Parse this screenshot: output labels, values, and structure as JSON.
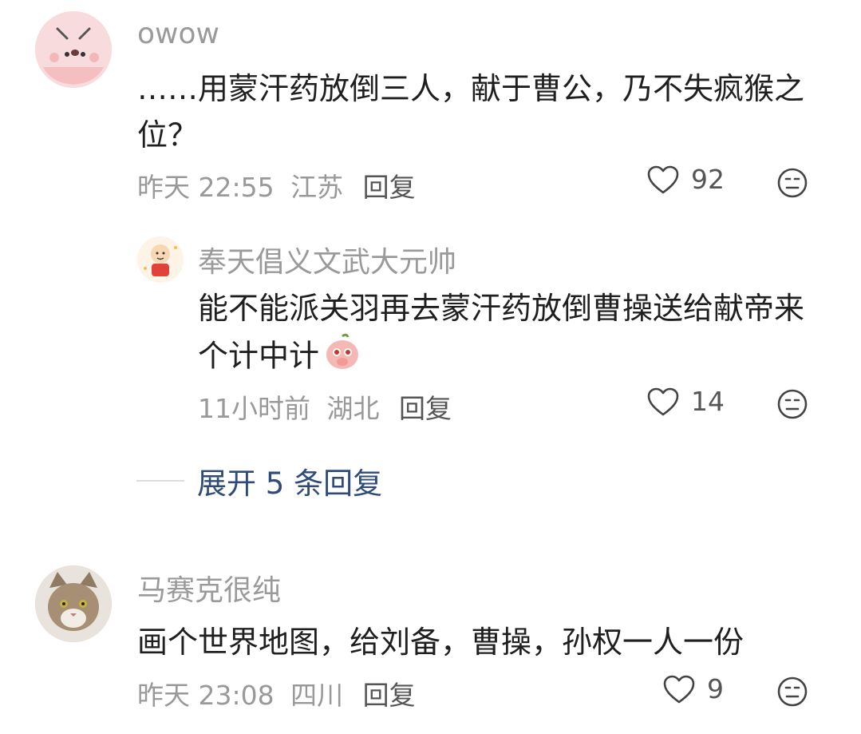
{
  "comments": [
    {
      "username": "owow",
      "text": "……用蒙汗药放倒三人，献于曹公，乃不失疯猴之位？",
      "time": "昨天 22:55",
      "location": "江苏",
      "reply_label": "回复",
      "likes": "92",
      "avatar_icon": "pink-face-avatar-icon"
    },
    {
      "username": "奉天倡义文武大元帅",
      "text": "能不能派关羽再去蒙汗药放倒曹操送给献帝来个计中计",
      "emoji_icon": "peach-emoji-icon",
      "time": "11小时前",
      "location": "湖北",
      "reply_label": "回复",
      "likes": "14",
      "avatar_icon": "cartoon-baby-avatar-icon"
    },
    {
      "username": "马赛克很纯",
      "text": "画个世界地图，给刘备，曹操，孙权一人一份",
      "time": "昨天 23:08",
      "location": "四川",
      "reply_label": "回复",
      "likes": "9",
      "avatar_icon": "cat-avatar-icon"
    }
  ],
  "expand_replies": "展开 5 条回复",
  "colors": {
    "username": "#9a9a9a",
    "meta": "#999999",
    "link": "#2e4b7a",
    "pink_avatar": "#f6cfd1"
  }
}
